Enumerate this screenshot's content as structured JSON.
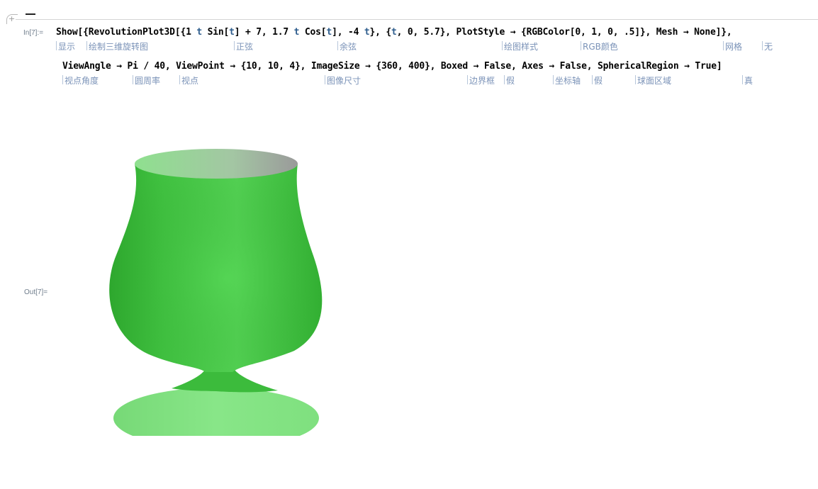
{
  "cell": {
    "toggle_glyph": "+",
    "in_label": "In[7]:=",
    "out_label": "Out[7]="
  },
  "code": {
    "line1": {
      "show": "Show",
      "p1": "[{",
      "fn": "RevolutionPlot3D",
      "p2": "[{1 ",
      "t1": "t",
      "p3": " Sin[",
      "t2": "t",
      "p4": "] + 7, 1.7 ",
      "t3": "t",
      "p5": " Cos[",
      "t4": "t",
      "p6": "], -4 ",
      "t5": "t",
      "p7": "}, {",
      "t6": "t",
      "p8": ", 0, 5.7}, PlotStyle → {RGBColor[0, 1, 0, .5]}, Mesh → None]},"
    },
    "line2": "ViewAngle → Pi / 40, ViewPoint → {10, 10, 4}, ImageSize → {360, 400}, Boxed → False, Axes → False, SphericalRegion → True]"
  },
  "hints_row1": [
    {
      "label": "显示"
    },
    {
      "label": "绘制三维旋转图"
    },
    {
      "label": "正弦"
    },
    {
      "label": "余弦"
    },
    {
      "label": "绘图样式"
    },
    {
      "label": "RGB颜色"
    },
    {
      "label": "网格"
    },
    {
      "label": "无"
    }
  ],
  "hints_row2": [
    {
      "label": "视点角度"
    },
    {
      "label": "圆周率"
    },
    {
      "label": "视点"
    },
    {
      "label": "图像尺寸"
    },
    {
      "label": "边界框"
    },
    {
      "label": "假"
    },
    {
      "label": "坐标轴"
    },
    {
      "label": "假"
    },
    {
      "label": "球面区域"
    },
    {
      "label": "真"
    }
  ],
  "output": {
    "graphic": "green-revolution-goblet",
    "colors": {
      "surface_light": "#8fe38f",
      "surface_mid": "#4fcf4f",
      "surface_dark": "#2a9f2a",
      "interior": "#9a9a9a"
    }
  }
}
